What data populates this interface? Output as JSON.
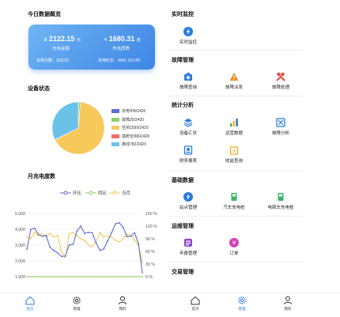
{
  "left": {
    "overview_title": "今日数据概览",
    "card": {
      "amount_value": "2122.15",
      "amount_unit": "元",
      "amount_label": "充电金额",
      "energy_value": "1680.31",
      "energy_unit": "度",
      "energy_label": "充电度数",
      "count_text": "充电次数：1622次",
      "duration_text": "充电时长：4941.13小时"
    },
    "device_title": "设备状态",
    "device_legend": [
      {
        "label": "充电中8/2420",
        "color": "#5a6fd6"
      },
      {
        "label": "故障25/2420",
        "color": "#8fce6b"
      },
      {
        "label": "空闲1599/2420",
        "color": "#f7c85a"
      },
      {
        "label": "插枪空闲6/2420",
        "color": "#ef6a6a"
      },
      {
        "label": "离线782/2420",
        "color": "#6bc2e8"
      }
    ],
    "monthly_title": "月充电度数",
    "chart_legend": [
      {
        "label": "环比",
        "color": "#5a6fd6"
      },
      {
        "label": "同比",
        "color": "#8fce6b"
      },
      {
        "label": "当月",
        "color": "#f7c85a"
      }
    ],
    "y_left_ticks": [
      "5,000",
      "4,000",
      "3,000",
      "2,000",
      "1,000"
    ],
    "y_right_ticks": [
      "150 %",
      "120 %",
      "90 %",
      "60 %",
      "30 %",
      "0 %"
    ]
  },
  "chart_data": [
    {
      "type": "pie",
      "title": "设备状态",
      "categories": [
        "充电中",
        "故障",
        "空闲",
        "插枪空闲",
        "离线"
      ],
      "values": [
        8,
        25,
        1599,
        6,
        782
      ],
      "total": 2420,
      "colors": [
        "#5a6fd6",
        "#8fce6b",
        "#f7c85a",
        "#ef6a6a",
        "#6bc2e8"
      ]
    },
    {
      "type": "line",
      "title": "月充电度数",
      "x": [
        1,
        2,
        3,
        4,
        5,
        6,
        7,
        8,
        9,
        10,
        11,
        12,
        13,
        14,
        15,
        16,
        17,
        18,
        19,
        20,
        21,
        22,
        23,
        24,
        25,
        26,
        27,
        28,
        29,
        30,
        31
      ],
      "series": [
        {
          "name": "当月",
          "axis": "left",
          "values": [
            3500,
            3400,
            3800,
            3600,
            3700,
            3500,
            3750,
            3500,
            3600,
            2600,
            2200,
            3700,
            3800,
            3600,
            3400,
            3300,
            3000,
            2900,
            3200,
            3800,
            3500,
            3600,
            3500,
            3300,
            3200,
            3400,
            3700,
            3600,
            3300,
            3000,
            1900
          ]
        },
        {
          "name": "环比",
          "axis": "right",
          "values": [
            65,
            112,
            115,
            100,
            96,
            98,
            70,
            62,
            56,
            48,
            49,
            75,
            77,
            108,
            120,
            103,
            105,
            104,
            80,
            62,
            66,
            85,
            104,
            125,
            128,
            117,
            95,
            96,
            104,
            78,
            10
          ]
        },
        {
          "name": "同比",
          "axis": "right",
          "values": [
            0,
            0,
            0,
            0,
            0,
            0,
            0,
            0,
            0,
            0,
            0,
            0,
            0,
            0,
            0,
            0,
            0,
            0,
            0,
            0,
            0,
            0,
            0,
            0,
            0,
            0,
            0,
            0,
            0,
            0,
            0
          ]
        }
      ],
      "ylim_left": [
        1000,
        5000
      ],
      "ylim_right": [
        0,
        150
      ]
    }
  ],
  "right": {
    "realtime_title": "实时监控",
    "realtime_item": "实时监控",
    "fault_title": "故障管理",
    "fault_items": [
      "故障查询",
      "故障派发",
      "故障处理"
    ],
    "stats_title": "统计分析",
    "stats_items": [
      "设备汇总",
      "运营数据",
      "故障分析",
      "财务报表",
      "收益查询"
    ],
    "basic_title": "基础数据",
    "basic_items": [
      "站点管理",
      "汽车充电桩",
      "电瓶车充电桩"
    ],
    "ops_title": "运维管理",
    "ops_items": [
      "年费管理",
      "订单"
    ],
    "trade_title": "交易管理"
  },
  "tabs_left": [
    {
      "label": "首页",
      "icon": "home-icon",
      "active": true
    },
    {
      "label": "管理",
      "icon": "gear-icon",
      "active": false
    },
    {
      "label": "我的",
      "icon": "user-icon",
      "active": false
    }
  ],
  "tabs_right": [
    {
      "label": "首页",
      "icon": "home-icon",
      "active": false
    },
    {
      "label": "管理",
      "icon": "gear-icon",
      "active": true
    },
    {
      "label": "我的",
      "icon": "user-icon",
      "active": false
    }
  ],
  "accent": "#2a7bdc"
}
